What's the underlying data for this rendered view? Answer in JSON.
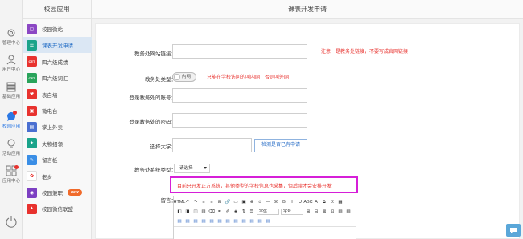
{
  "rail": {
    "items": [
      {
        "label": "管理中心",
        "icon": "gear-icon"
      },
      {
        "label": "用户中心",
        "icon": "user-icon"
      },
      {
        "label": "基础应用",
        "icon": "list-icon"
      },
      {
        "label": "校园应用",
        "icon": "chat-bubble-icon",
        "active": true
      },
      {
        "label": "活动应用",
        "icon": "bulb-icon"
      },
      {
        "label": "应用中心",
        "icon": "grid-icon"
      }
    ],
    "power_icon": "power-icon"
  },
  "sidebar": {
    "title": "校园应用",
    "apps": [
      {
        "label": "校园微站",
        "icon_color": "#8b47c4",
        "glyph": "▢"
      },
      {
        "label": "课表开发申请",
        "icon_color": "#1aa38a",
        "glyph": "☰",
        "active": true
      },
      {
        "label": "四六级成绩",
        "icon_color": "#e8322e",
        "glyph": "CET"
      },
      {
        "label": "四六级词汇",
        "icon_color": "#29a35a",
        "glyph": "CET"
      },
      {
        "label": "表白墙",
        "icon_color": "#e8322e",
        "glyph": "❤"
      },
      {
        "label": "微电台",
        "icon_color": "#e8322e",
        "glyph": "▣"
      },
      {
        "label": "掌上外卖",
        "icon_color": "#4a6fd1",
        "glyph": "▤"
      },
      {
        "label": "失物招领",
        "icon_color": "#1aa38a",
        "glyph": "✦"
      },
      {
        "label": "留言板",
        "icon_color": "#3a8ee6",
        "glyph": "✎"
      },
      {
        "label": "老乡",
        "icon_color": "#ffffff",
        "glyph": "✿"
      },
      {
        "label": "校园兼职",
        "icon_color": "#7c3fc2",
        "glyph": "◉",
        "badge": "new"
      },
      {
        "label": "校园微信联盟",
        "icon_color": "#e8322e",
        "glyph": "▲"
      }
    ]
  },
  "header": {
    "title": "课表开发申请"
  },
  "form": {
    "url_label": "教务处网站链接：",
    "url_note": "注意：是教务处链接，不要写成官网链接",
    "type_label": "教务处类型：",
    "type_toggle": "内网",
    "type_note": "只能在学校访问的叫内网，否则叫外网",
    "account_label": "登录教务处的账号：",
    "password_label": "登录教务处的密码：",
    "school_label": "选择大学：",
    "school_button": "检测是否已有申请",
    "system_label": "教务处系统类型：",
    "system_select": "请选择",
    "notice": "目前只开发正方系统，其他类型的学校信息也采集，但后续才会安排开发",
    "message_label": "留言："
  },
  "editor": {
    "toolbar_row1": [
      "HTML",
      "↶",
      "↷",
      "≡",
      "≡",
      "⊟",
      "🔗",
      "▭",
      "▣",
      "⊕",
      "☺",
      "—",
      "66",
      "B",
      "I",
      "U",
      "ABC",
      "A",
      "⧉",
      "X",
      "▦"
    ],
    "toolbar_row2": [
      "◧",
      "◨",
      "◫",
      "▥",
      "⌫",
      "✒",
      "✐",
      "◈",
      "⇅",
      "☰",
      "字体",
      "字号",
      "⊞",
      "⊟",
      "⊠",
      "⊡",
      "▧",
      "▨"
    ],
    "toolbar_row3": [
      "▤",
      "▤",
      "▤",
      "▤",
      "▤",
      "▤",
      "▤",
      "▤",
      "▤",
      "▤",
      "▤",
      "▤"
    ],
    "font_select": "字体",
    "size_select": "字号"
  },
  "colors": {
    "accent": "#2b78e4",
    "active_bg": "#dbe7f4",
    "warning": "#e8322e",
    "highlight_border": "#d61fd8"
  }
}
